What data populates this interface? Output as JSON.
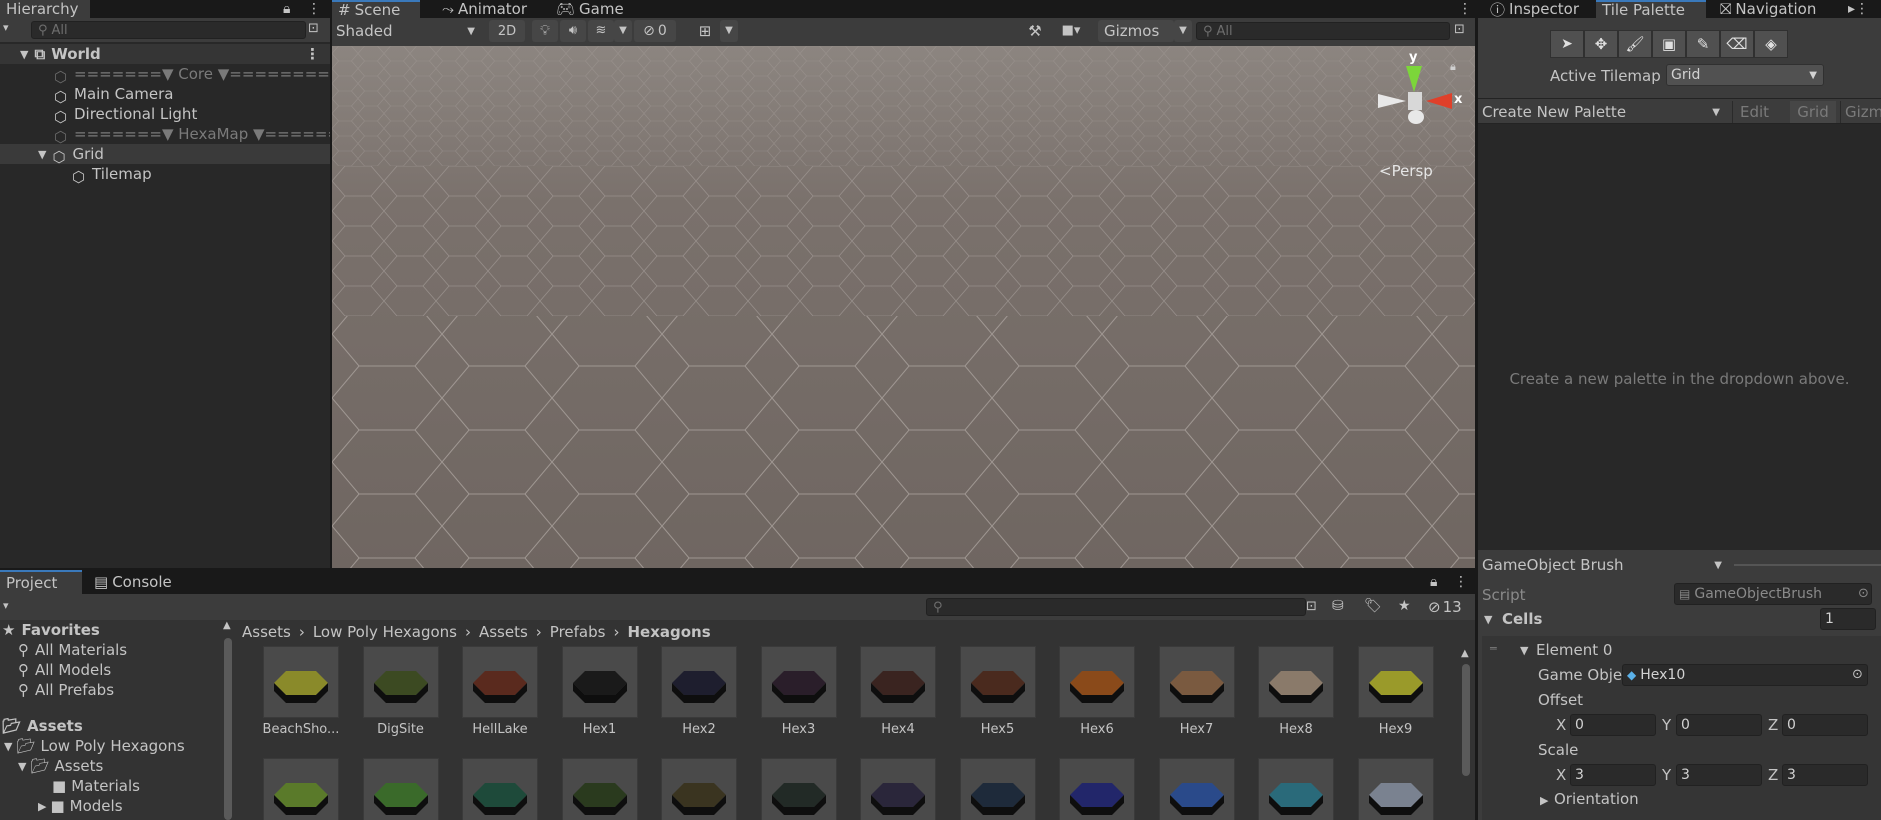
{
  "hierarchy": {
    "tab_label": "Hierarchy",
    "search_placeholder": "All",
    "items": [
      {
        "label": "World"
      },
      {
        "label": "=======▼ Core ▼=========="
      },
      {
        "label": "Main Camera"
      },
      {
        "label": "Directional Light"
      },
      {
        "label": "=======▼ HexaMap ▼======="
      },
      {
        "label": "Grid"
      },
      {
        "label": "Tilemap"
      }
    ]
  },
  "scene": {
    "tabs": [
      {
        "label": "Scene"
      },
      {
        "label": "Animator"
      },
      {
        "label": "Game"
      }
    ],
    "shading_mode": "Shaded",
    "mode_2d": "2D",
    "hidden_count": "0",
    "gizmos_label": "Gizmos",
    "search_placeholder": "All",
    "persp_label": "<Persp",
    "axis_y": "y",
    "axis_x": "x"
  },
  "tile_palette": {
    "tabs": [
      {
        "label": "Inspector"
      },
      {
        "label": "Tile Palette"
      },
      {
        "label": "Navigation"
      }
    ],
    "active_tilemap_label": "Active Tilemap",
    "active_tilemap_value": "Grid",
    "palette_dropdown": "Create New Palette",
    "edit_label": "Edit",
    "grid_label": "Grid",
    "gizmos_label": "Gizmo",
    "empty_message": "Create a new palette in the dropdown above.",
    "brush": "GameObject Brush",
    "script_label": "Script",
    "script_value": "GameObjectBrush",
    "cells_label": "Cells",
    "cells_value": "1",
    "element_label": "Element 0",
    "game_object_label": "Game Obje",
    "game_object_value": "Hex10",
    "offset_label": "Offset",
    "offset": {
      "x": "0",
      "y": "0",
      "z": "0"
    },
    "scale_label": "Scale",
    "scale": {
      "x": "3",
      "y": "3",
      "z": "3"
    },
    "orientation_label": "Orientation",
    "x_label": "X",
    "y_label": "Y",
    "z_label": "Z"
  },
  "project": {
    "tabs": [
      {
        "label": "Project"
      },
      {
        "label": "Console"
      }
    ],
    "hidden_packages": "13",
    "favorites_label": "Favorites",
    "favorites": [
      {
        "label": "All Materials"
      },
      {
        "label": "All Models"
      },
      {
        "label": "All Prefabs"
      }
    ],
    "assets_label": "Assets",
    "tree": [
      {
        "label": "Low Poly Hexagons"
      },
      {
        "label": "Assets"
      },
      {
        "label": "Materials"
      },
      {
        "label": "Models"
      }
    ],
    "breadcrumb": [
      {
        "label": "Assets"
      },
      {
        "label": "Low Poly Hexagons"
      },
      {
        "label": "Assets"
      },
      {
        "label": "Prefabs"
      },
      {
        "label": "Hexagons"
      }
    ],
    "assets": [
      {
        "label": "BeachSho...",
        "color": "#8a8a2a"
      },
      {
        "label": "DigSite",
        "color": "#3c4a22"
      },
      {
        "label": "HellLake",
        "color": "#5a2a1e"
      },
      {
        "label": "Hex1",
        "color": "#1a1a1a"
      },
      {
        "label": "Hex2",
        "color": "#1e1e2e"
      },
      {
        "label": "Hex3",
        "color": "#2a1e2a"
      },
      {
        "label": "Hex4",
        "color": "#3a2420"
      },
      {
        "label": "Hex5",
        "color": "#4a2a1e"
      },
      {
        "label": "Hex6",
        "color": "#8a4a1a"
      },
      {
        "label": "Hex7",
        "color": "#7a5a40"
      },
      {
        "label": "Hex8",
        "color": "#8a7a6a"
      },
      {
        "label": "Hex9",
        "color": "#9a9a2a"
      }
    ],
    "assets_row2_colors": [
      "#5a7a2a",
      "#3a6a2a",
      "#1e4a3a",
      "#2a3a1e",
      "#3a3420",
      "#222a26",
      "#2a263a",
      "#1e2a3a",
      "#22266a",
      "#2a4a8a",
      "#2a6a7a",
      "#7a8290"
    ]
  },
  "colors": {
    "accent": "#3a79bb",
    "panel": "#282828",
    "tab_active": "#3c3c3c"
  }
}
